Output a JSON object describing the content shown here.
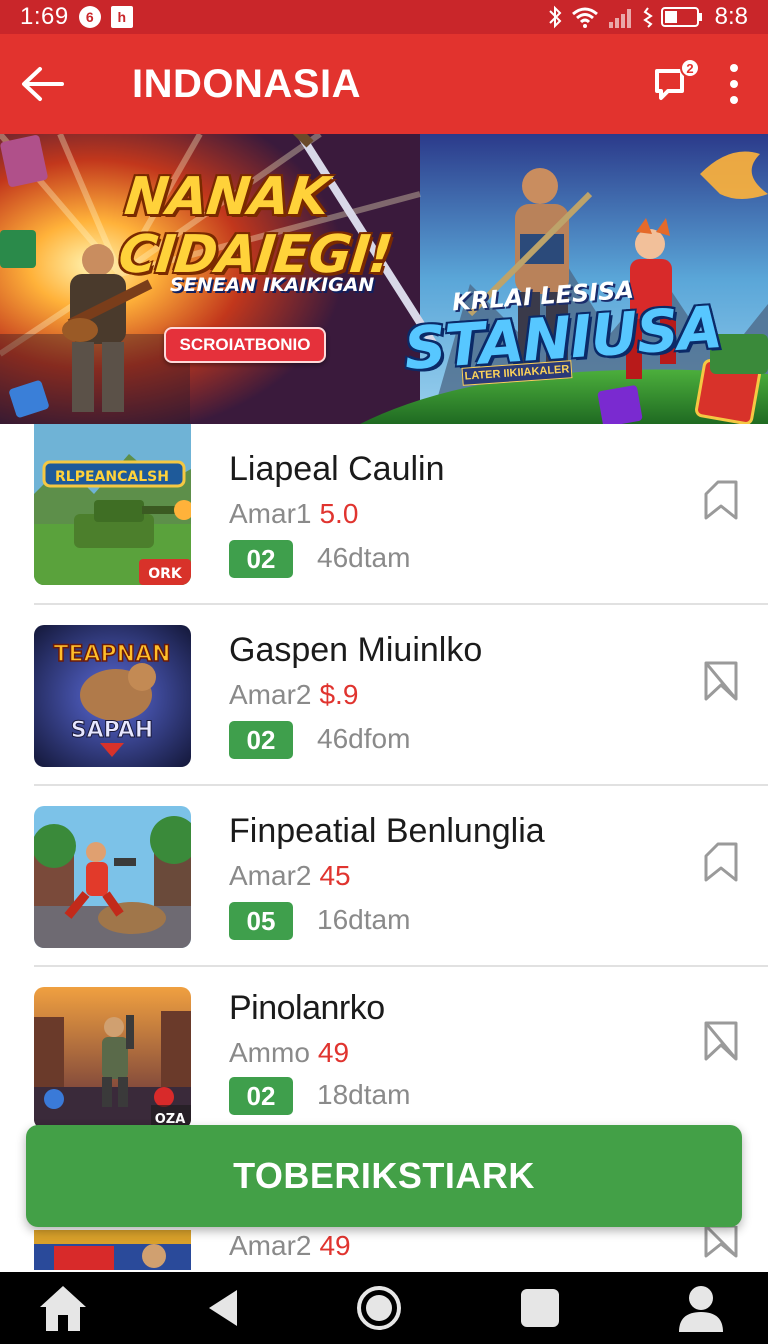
{
  "status_bar": {
    "time": "1:69",
    "badge_1": "6",
    "badge_2": "h",
    "clock": "8:8"
  },
  "app_bar": {
    "title": "INDONASIA",
    "chat_count": "2"
  },
  "banner": {
    "title_line_1": "NANAK",
    "title_line_2": "CIDAIEGI!",
    "subtitle": "SENEAN IKAIKIGAN",
    "cta_label": "SCROIATBONIO",
    "kicker": "KRLAI LESISA",
    "logo": "STANIUSA",
    "tag": "LATER IIKIIAKALER",
    "colors": {
      "title": "#ffd23a",
      "logo": "#57c7ff",
      "cta": "#e5313b"
    }
  },
  "games": [
    {
      "name": "Liapeal Caulin",
      "meta_label": "Amar1",
      "rating": "5.0",
      "count": "02",
      "time": "46dtam",
      "thumb_title": "RLPEANCALSH",
      "thumb_corner": "ORK"
    },
    {
      "name": "Gaspen Miuinlko",
      "meta_label": "Amar2",
      "rating": "$.9",
      "count": "02",
      "time": "46dfom",
      "thumb_title": "TEAPNAN",
      "thumb_sub": "SAPAH"
    },
    {
      "name": "Finpeatial Benlunglia",
      "meta_label": "Amar2",
      "rating": "45",
      "count": "05",
      "time": "16dtam"
    },
    {
      "name": "Pinolanrko",
      "meta_label": "Ammo",
      "rating": "49",
      "count": "02",
      "time": "18dtam",
      "thumb_corner": "OZA"
    }
  ],
  "partial_row": {
    "meta_label": "Amar2",
    "rating": "49"
  },
  "cta": {
    "label": "TOBERIKSTIARK"
  },
  "nav": {
    "items": [
      "home-icon",
      "back-icon",
      "home-circle-icon",
      "recents-icon",
      "profile-icon"
    ]
  },
  "theme": {
    "primary": "#e2332e",
    "status": "#c9262a",
    "green": "#43a047",
    "badge_green": "#3f9f4c",
    "rating": "#e0342f"
  }
}
